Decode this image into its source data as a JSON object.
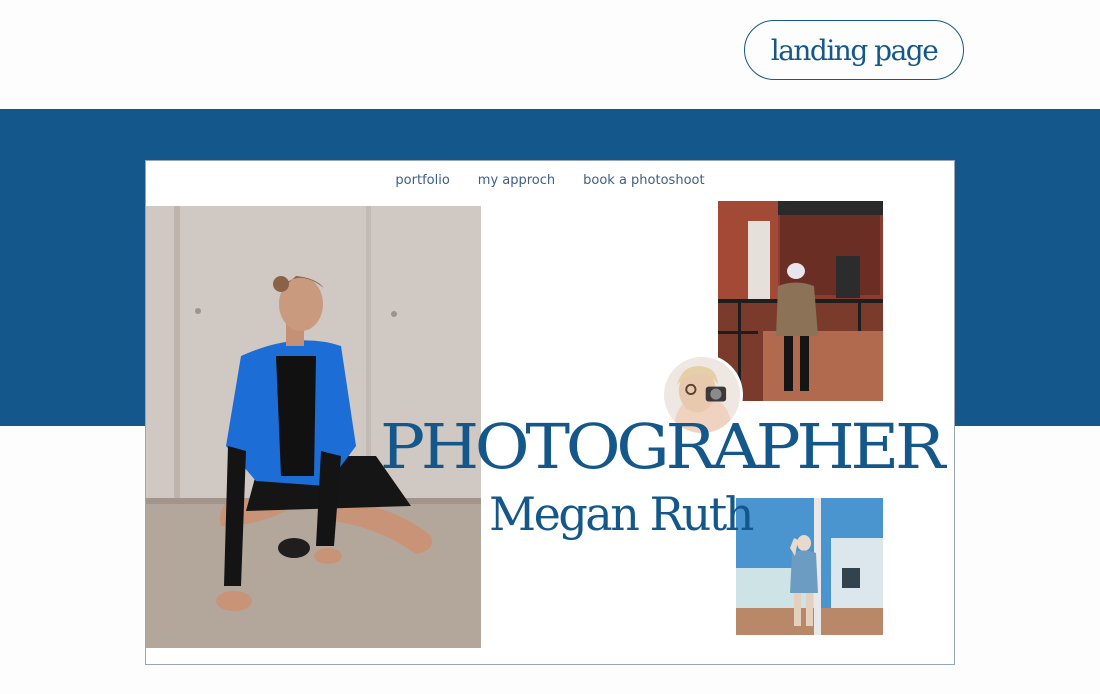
{
  "badge": {
    "label": "landing page"
  },
  "nav": {
    "items": [
      {
        "label": "portfolio"
      },
      {
        "label": "my approch"
      },
      {
        "label": "book a photoshoot"
      }
    ]
  },
  "hero": {
    "title": "PHOTOGRAPHER",
    "name": "Megan Ruth"
  },
  "colors": {
    "brand_blue": "#14578a",
    "nav_text": "#3d5f86",
    "page_background": "#fdfdfe"
  }
}
